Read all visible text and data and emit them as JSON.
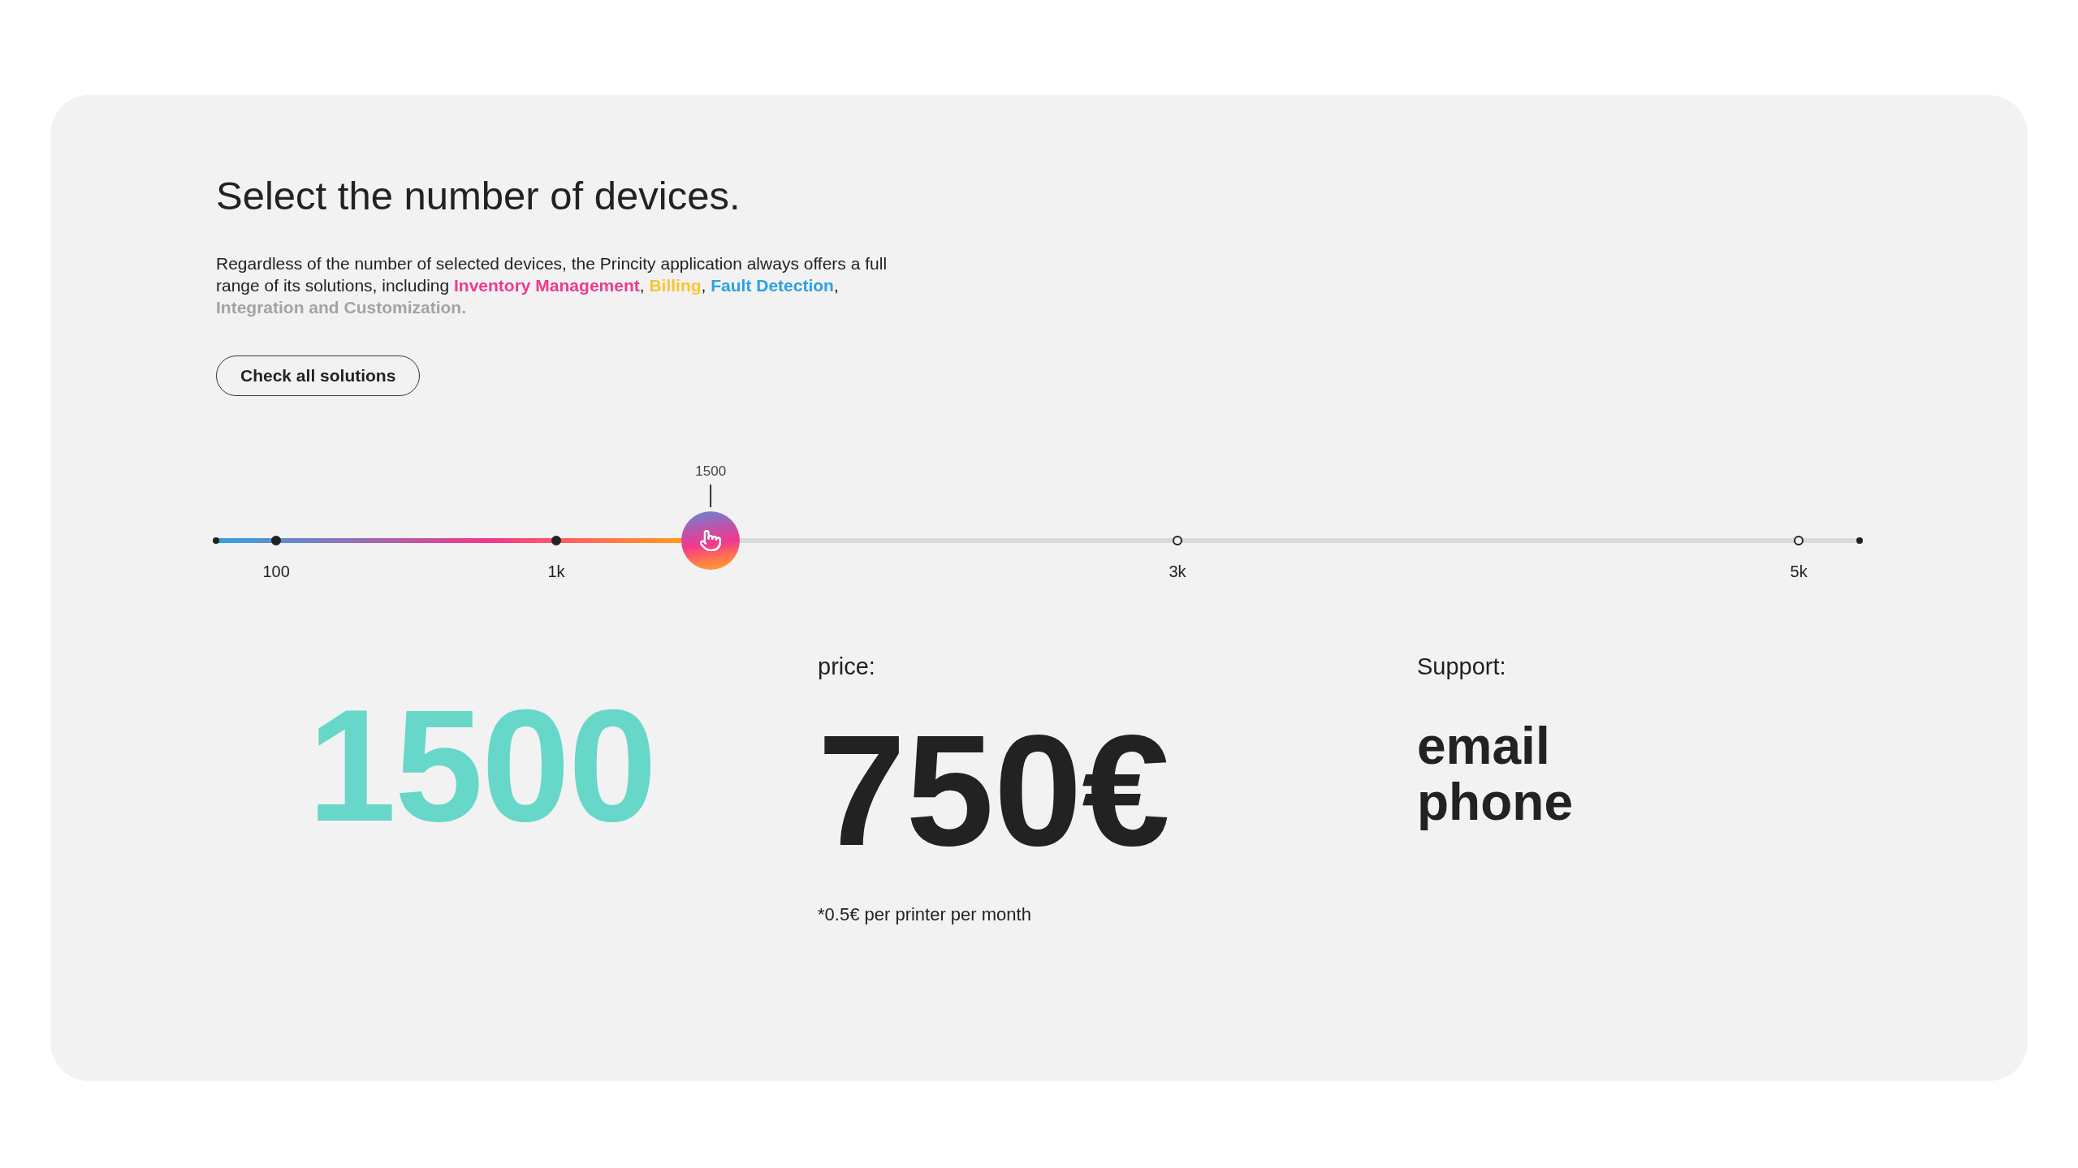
{
  "heading": "Select the number of devices.",
  "intro": {
    "segments": [
      {
        "kind": "plain",
        "text": "Regardless of the number of selected devices, the Princity application always offers a full range of its solutions, including "
      },
      {
        "kind": "solution",
        "text": "Inventory Management",
        "color": "#ef3a8c"
      },
      {
        "kind": "plain",
        "text": ", "
      },
      {
        "kind": "solution",
        "text": "Billing",
        "color": "#fbc531"
      },
      {
        "kind": "plain",
        "text": ", "
      },
      {
        "kind": "solution",
        "text": "Fault Detection",
        "color": "#2aa3e0"
      },
      {
        "kind": "plain",
        "text": ", "
      },
      {
        "kind": "solution",
        "text": "Integration and Customization.",
        "color": "#a3a3a3"
      }
    ]
  },
  "button": {
    "label": "Check all solutions"
  },
  "slider": {
    "level": 0.301,
    "value_label": "1500",
    "ticks": [
      {
        "label": "100",
        "reached": true
      },
      {
        "label": "1k",
        "reached": true
      },
      {
        "label": "3k",
        "reached": false
      },
      {
        "label": "5k",
        "reached": false
      }
    ]
  },
  "device_count": "1500",
  "price": {
    "label": "price:",
    "amount": "750€",
    "note": "*0.5€ per printer per month"
  },
  "support": {
    "label": "Support:",
    "channels": [
      "email",
      "phone"
    ]
  }
}
